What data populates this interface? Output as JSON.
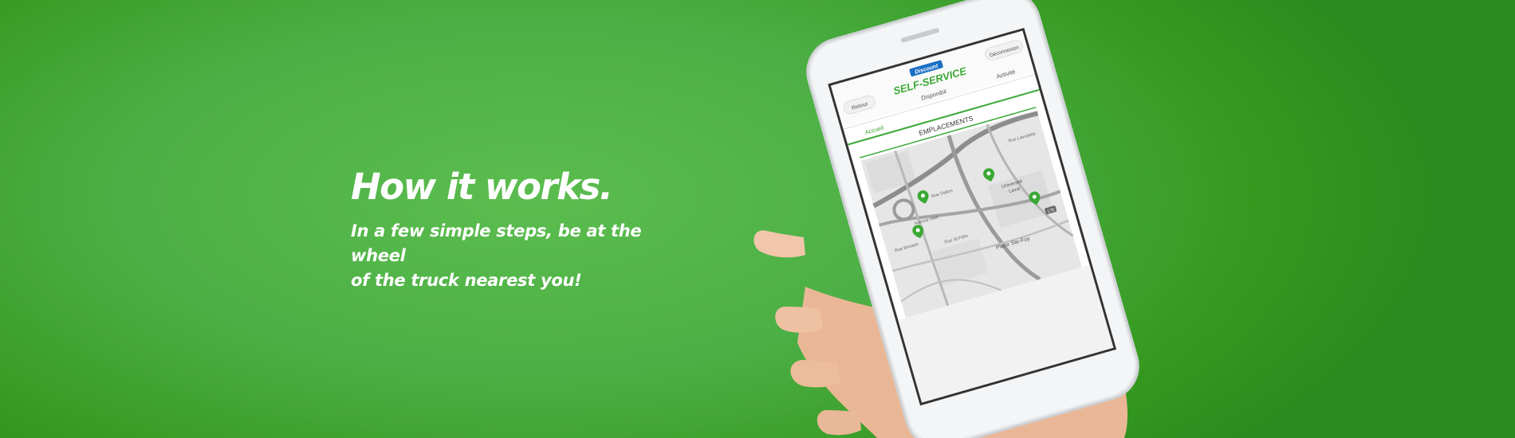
{
  "hero": {
    "title": "How it works.",
    "subtitle_line1": "In a few simple steps, be at the wheel",
    "subtitle_line2": "of the truck nearest you!"
  },
  "app": {
    "brand_top": "Discount",
    "brand_main": "SELF-SERVICE",
    "back_button": "Retour",
    "logout_button": "Déconnexion",
    "tabs": [
      "Accueil",
      "Disponibil",
      "Activité"
    ],
    "active_tab": "Accueil",
    "section_title": "EMPLACEMENTS",
    "map_labels": {
      "street1": "Rue Laviolette",
      "street2": "Rue Dalton",
      "street3": "Avenue Watt",
      "street4": "Rue Einstein",
      "street5": "Rue St-Félix",
      "place": "Place Ste-Foy",
      "university1": "Université",
      "university2": "Laval",
      "highway": "175"
    },
    "colors": {
      "accent": "#3aa935",
      "brand_blue": "#1a6fc4"
    }
  }
}
